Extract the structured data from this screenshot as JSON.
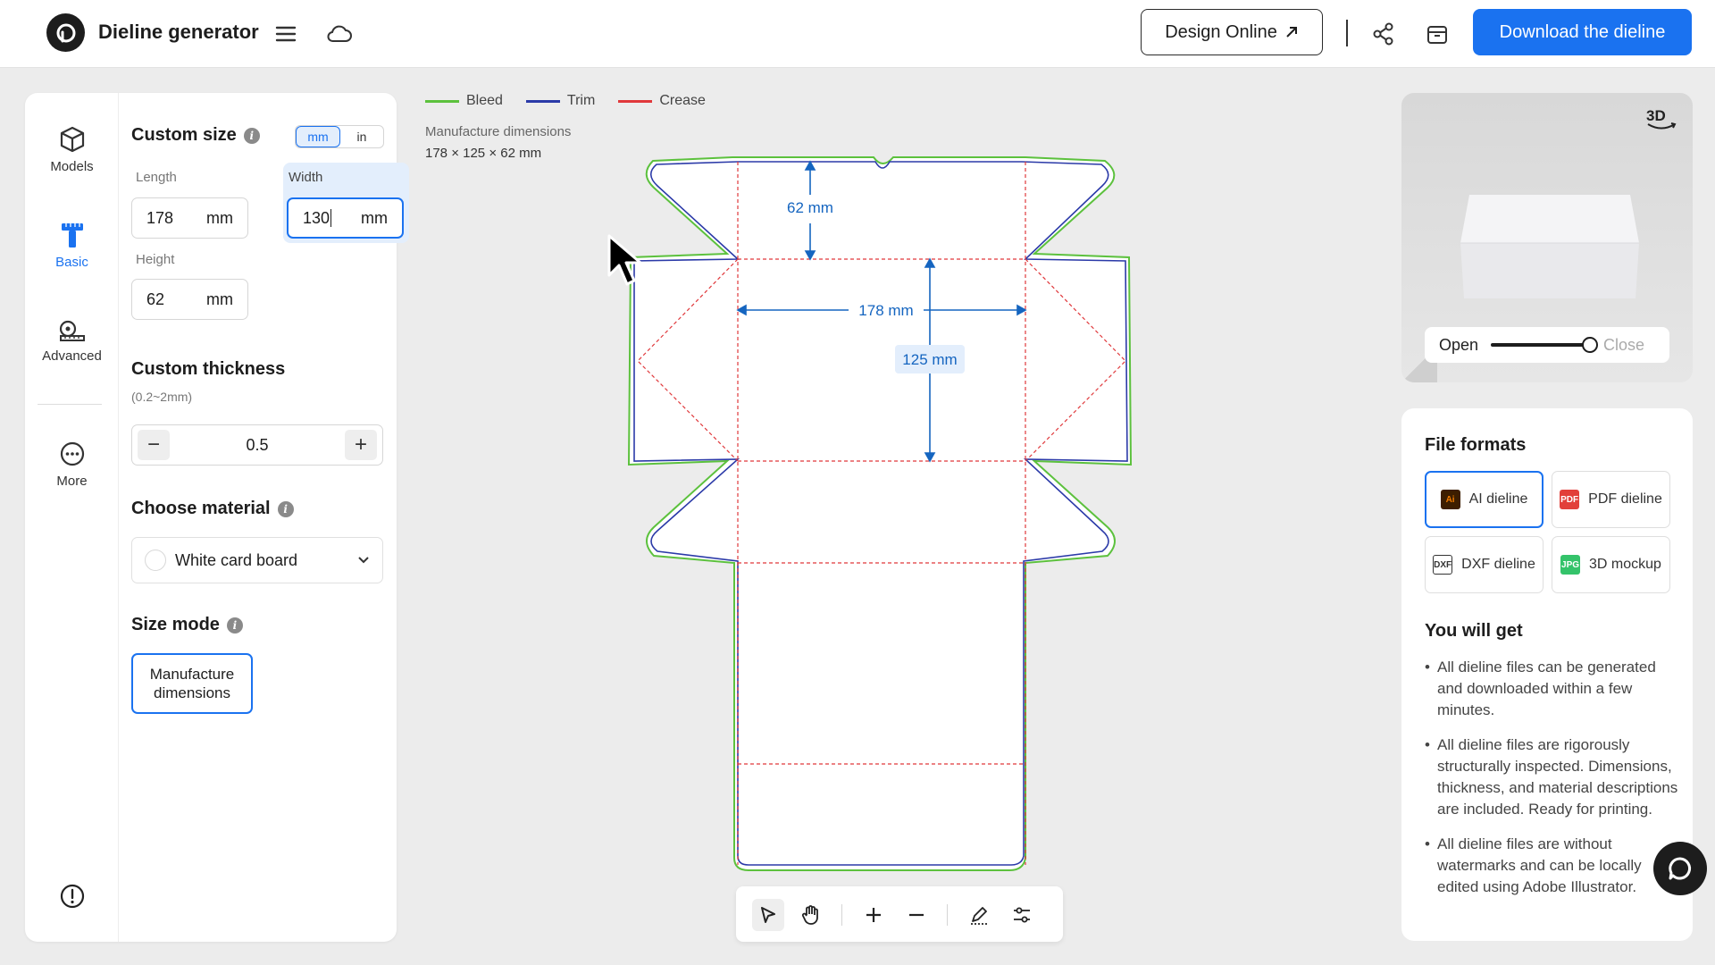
{
  "header": {
    "title": "Dieline generator",
    "design_online": "Design Online",
    "download": "Download the dieline"
  },
  "nav": [
    {
      "label": "Models",
      "icon": "cube-icon"
    },
    {
      "label": "Basic",
      "icon": "ruler-t-icon"
    },
    {
      "label": "Advanced",
      "icon": "tape-measure-icon"
    },
    {
      "label": "More",
      "icon": "more-icon"
    }
  ],
  "custom_size": {
    "title": "Custom size",
    "unit_mm": "mm",
    "unit_in": "in",
    "length_label": "Length",
    "length_value": "178",
    "width_label": "Width",
    "width_value": "130",
    "height_label": "Height",
    "height_value": "62",
    "unit": "mm"
  },
  "thickness": {
    "title": "Custom thickness",
    "range": "(0.2~2mm)",
    "value": "0.5"
  },
  "material": {
    "title": "Choose material",
    "value": "White card board"
  },
  "size_mode": {
    "title": "Size mode",
    "value": "Manufacture dimensions"
  },
  "legend": [
    {
      "label": "Bleed",
      "color": "#5cc13d"
    },
    {
      "label": "Trim",
      "color": "#2b3aa8"
    },
    {
      "label": "Crease",
      "color": "#e0383b"
    }
  ],
  "canvas": {
    "dims_label": "Manufacture dimensions",
    "dims_value": "178 × 125 × 62 mm",
    "dim_height": "62 mm",
    "dim_length": "178 mm",
    "dim_width": "125 mm"
  },
  "preview": {
    "badge": "3D",
    "open": "Open",
    "close": "Close",
    "openness": 1.0
  },
  "file_formats": {
    "title": "File formats",
    "items": [
      {
        "label": "AI dieline",
        "icon": "ai-file-icon",
        "color": "#f27b00"
      },
      {
        "label": "PDF dieline",
        "icon": "pdf-file-icon",
        "color": "#e2403a"
      },
      {
        "label": "DXF dieline",
        "icon": "dxf-file-icon",
        "color": "#333333"
      },
      {
        "label": "3D mockup",
        "icon": "jpg-file-icon",
        "color": "#34c36a"
      }
    ]
  },
  "you_will_get": {
    "title": "You will get",
    "items": [
      "All dieline files can be generated and downloaded within a few minutes.",
      "All dieline files are rigorously structurally inspected. Dimensions, thickness, and material descriptions are included. Ready for printing.",
      "All dieline files are without watermarks and can be locally edited using Adobe Illustrator."
    ]
  },
  "colors": {
    "accent": "#1a72f0",
    "bleed": "#5cc13d",
    "trim": "#2b3aa8",
    "crease": "#e0383b",
    "dimension": "#1565c0"
  }
}
